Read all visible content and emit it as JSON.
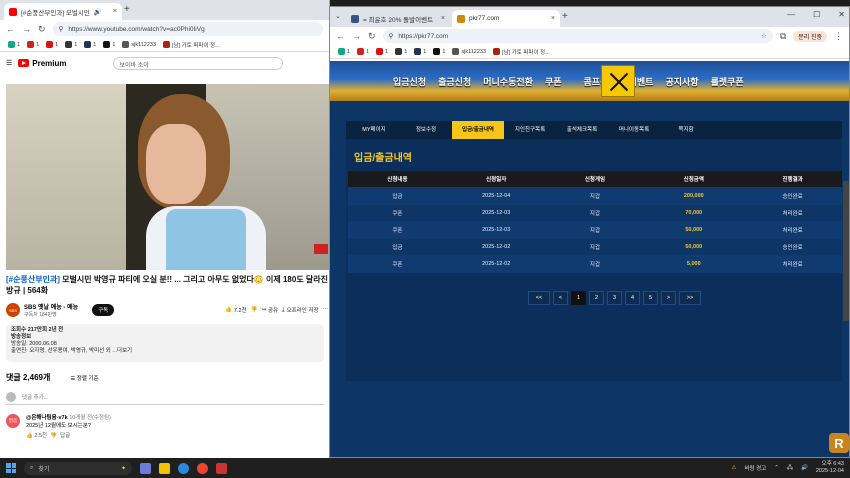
{
  "left_tab": {
    "title": "[#순풍산부인과] 모벌시민",
    "audio": "🔊"
  },
  "left_url": "https://www.youtube.com/watch?v=ac0Phi0IiVg",
  "right_tabs": [
    {
      "title": "= 최윤호 20% 돌발이벤트"
    },
    {
      "title": "pkr77.com"
    }
  ],
  "right_url": "https://pkr77.com",
  "bookmarks": [
    {
      "label": "1"
    },
    {
      "label": "1"
    },
    {
      "label": "1"
    },
    {
      "label": "1"
    },
    {
      "label": "1"
    },
    {
      "label": "1"
    },
    {
      "label": "sjk112233"
    },
    {
      "label": "[남] 가토 퍼파이 정..."
    }
  ],
  "youtube": {
    "logo": "Premium",
    "search": "보이바 소이",
    "title_tag": "[#순풍산부인과]",
    "title": " 모벌시민 박영규 파티에 오실 분!! ... 그리고 아무도 없었다😳 이제 180도 달라진 방규 | 564화",
    "channel": "SBS 옛날 예능 - 예능",
    "subs": "구독자 184만명",
    "subscribe": "구독",
    "likes": "7.2천",
    "share": "공유",
    "offline": "오프라인 저장",
    "desc_lines": [
      "조회수 217만회 2년 전",
      "방송정보",
      "방송일: 2000.06.08",
      "출연진: 오지명, 선우용여, 박영규, 박미선 외 ...더보기"
    ],
    "comments_count": "댓글 2,469개",
    "sort": "정렬 기준",
    "comment_placeholder": "댓글 추가...",
    "comment": {
      "author": "@은해나팀음-v7k",
      "time": "10개월 전(수정됨)",
      "text": "2025년 12월에도 보시는분?",
      "likes": "2.5천",
      "reply": "답글",
      "avatar": "맑음"
    }
  },
  "site": {
    "nav": [
      "입금신청",
      "출금신청",
      "머니수동전환",
      "쿠폰",
      "콤프신청",
      "이벤트",
      "공지사항",
      "룰렛쿠폰"
    ],
    "subtabs": [
      {
        "label": "MY페이지"
      },
      {
        "label": "정보수정"
      },
      {
        "label": "입금/출금내역"
      },
      {
        "label": "지인친구목록"
      },
      {
        "label": "출석체크목록"
      },
      {
        "label": "머니이동목록"
      },
      {
        "label": "쪽지함"
      }
    ],
    "active_tab": "입금/출금내역",
    "page_title": "입금/출금내역",
    "columns": [
      "신청내용",
      "신청일자",
      "신청게임",
      "신청금액",
      "진행결과"
    ],
    "rows": [
      [
        "입금",
        "2025-12-04",
        "지갑",
        "200,000",
        "승인완료"
      ],
      [
        "쿠폰",
        "2025-12-03",
        "지갑",
        "70,000",
        "처리완료"
      ],
      [
        "쿠폰",
        "2025-12-03",
        "지갑",
        "50,000",
        "처리완료"
      ],
      [
        "입금",
        "2025-12-02",
        "지갑",
        "50,000",
        "승인완료"
      ],
      [
        "쿠폰",
        "2025-12-02",
        "지갑",
        "5,000",
        "처리완료"
      ]
    ],
    "pager": [
      "<<",
      "<",
      "1",
      "2",
      "3",
      "4",
      "5",
      ">",
      ">>"
    ],
    "pager_active": "1",
    "logo": "R"
  },
  "taskbar": {
    "search": "찾기",
    "weather": "바람 경고",
    "time": "오후 6:43",
    "date": "2025-12-04"
  },
  "profile": "분리 진중"
}
